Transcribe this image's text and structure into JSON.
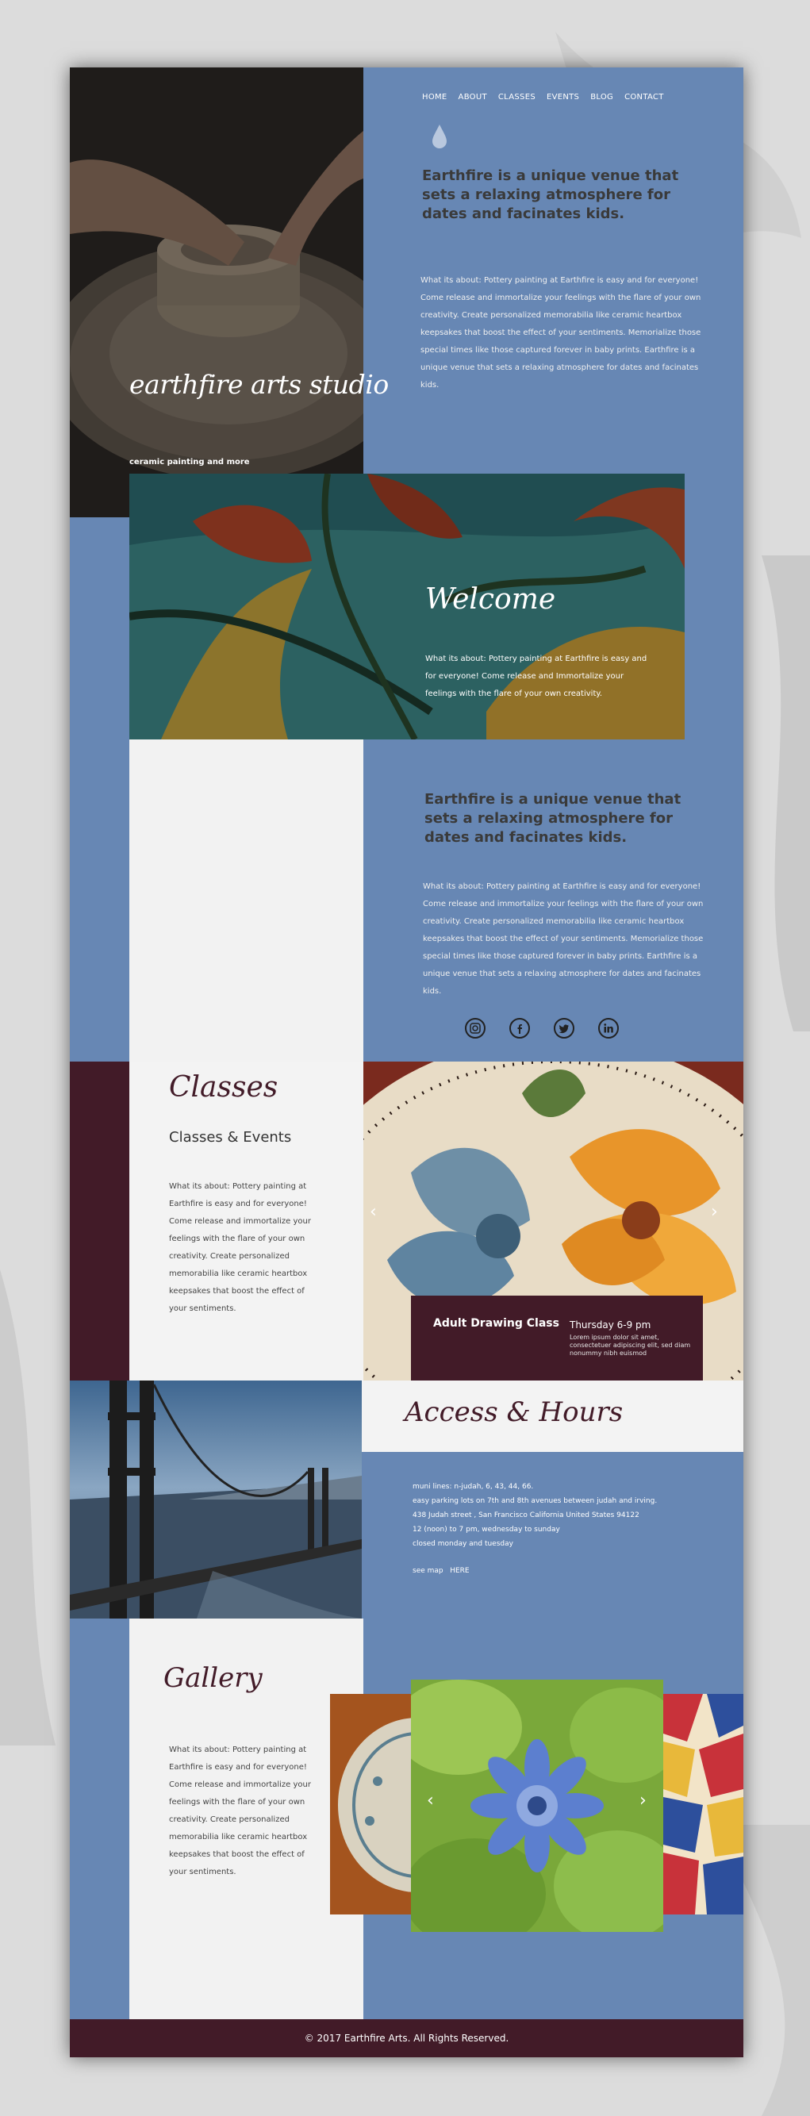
{
  "nav": {
    "items": [
      "HOME",
      "ABOUT",
      "CLASSES",
      "EVENTS",
      "BLOG",
      "CONTACT"
    ]
  },
  "hero": {
    "brand": "earthfire arts studio",
    "tagline": "ceramic painting and more"
  },
  "intro": {
    "lead": "Earthfire is a unique venue that sets a relaxing atmosphere for dates and facinates kids.",
    "body": "What its about: Pottery painting at Earthfire is easy and for everyone! Come release and immortalize your feelings with the flare of your own creativity. Create personalized memorabilia like ceramic heartbox keepsakes that boost the effect of your sentiments. Memorialize those special times like those captured forever in baby prints. Earthfire is a unique venue that sets a relaxing atmosphere for dates and facinates kids."
  },
  "welcome": {
    "title": "Welcome",
    "body": "What its about: Pottery painting at Earthfire is easy and for everyone! Come release and Immortalize your feelings with the flare of your own creativity."
  },
  "about": {
    "lead": "Earthfire is a unique venue that sets a relaxing atmosphere for dates and facinates kids.",
    "body": "What its about: Pottery painting at Earthfire is easy and for everyone! Come release and immortalize your feelings with the flare of your own creativity. Create personalized memorabilia like ceramic heartbox keepsakes that boost the effect of your sentiments. Memorialize those special times like those captured forever in baby prints. Earthfire is a unique venue that sets a relaxing atmosphere for dates and facinates kids.",
    "social": [
      "instagram-icon",
      "facebook-icon",
      "twitter-icon",
      "linkedin-icon"
    ]
  },
  "classes": {
    "title": "Classes",
    "subtitle": "Classes & Events",
    "body": "What its about: Pottery painting at Earthfire is easy and for everyone! Come release and immortalize your feelings with the flare of your own creativity. Create personalized memorabilia like ceramic heartbox keepsakes that boost the effect of your sentiments.",
    "event": {
      "name": "Adult Drawing Class",
      "time": "Thursday 6-9 pm",
      "description": "Lorem ipsum dolor sit amet, consectetuer adipiscing elit, sed diam nonummy nibh euismod"
    },
    "prev_arrow": "‹",
    "next_arrow": "›"
  },
  "access": {
    "title": "Access & Hours",
    "lines": [
      "muni lines: n-judah, 6, 43, 44, 66.",
      "easy parking lots on 7th and 8th avenues between judah and irving.",
      "438 Judah street , San Francisco California United States 94122",
      "12 (noon) to 7 pm, wednesday to sunday",
      "closed monday and tuesday"
    ],
    "map_label": "see map",
    "map_link": "HERE"
  },
  "gallery": {
    "title": "Gallery",
    "body": "What its about: Pottery painting at Earthfire is easy and for everyone! Come release and immortalize your feelings with the flare of your own creativity. Create personalized memorabilia like ceramic heartbox keepsakes that boost the effect of your sentiments.",
    "prev_arrow": "‹",
    "next_arrow": "›"
  },
  "footer": {
    "copyright": "© 2017 Earthfire Arts. All Rights Reserved."
  },
  "colors": {
    "page_blue": "#6787b4",
    "maroon": "#421b28",
    "panel_white": "#f2f2f2"
  }
}
